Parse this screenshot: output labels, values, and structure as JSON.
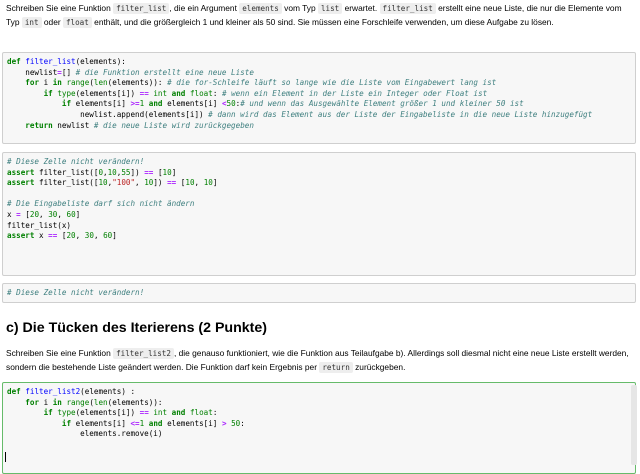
{
  "intro": {
    "t1": "Schreiben Sie eine Funktion ",
    "c1": "filter_list",
    "t2": ", die ein Argument ",
    "c2": "elements",
    "t3": " vom Typ ",
    "c3": "list",
    "t4": " erwartet. ",
    "c4": "filter_list",
    "t5": " erstellt eine neue Liste, die nur die Elemente vom Typ ",
    "c5": "int",
    "t6": " oder ",
    "c6": "float",
    "t7": " enthält, und die größergleich 1 und kleiner als 50 sind. Sie müssen eine Forschleife verwenden, um diese Aufgabe zu lösen."
  },
  "cell1": {
    "lines": [
      "def filter_list(elements):",
      "    newlist=[] # die Funktion erstellt eine neue Liste",
      "    for i in range(len(elements)): # die for-Schleife läuft so lange wie die Liste vom Eingabewert lang ist",
      "        if type(elements[i]) == int and float: # wenn ein Element in der Liste ein Integer oder Float ist",
      "            if elements[i] >=1 and elements[i] <50:# und wenn das Ausgewählte Element größer 1 und kleiner 50 ist",
      "                newlist.append(elements[i]) # dann wird das Element aus der Liste der Eingabeliste in die neue Liste hinzugefügt",
      "    return newlist # die neue Liste wird zurückgegeben"
    ]
  },
  "cell2": {
    "lines": [
      "# Diese Zelle nicht verändern!",
      "assert filter_list([0,10,55]) == [10]",
      "assert filter_list([10,\"100\", 10]) == [10, 10]",
      "",
      "# Die Eingabeliste darf sich nicht ändern",
      "x = [20, 30, 60]",
      "filter_list(x)",
      "assert x == [20, 30, 60]"
    ]
  },
  "cell3": {
    "lines": [
      "# Diese Zelle nicht verändern!"
    ]
  },
  "heading": "c) Die Tücken des Iterierens (2 Punkte)",
  "task": {
    "t1": "Schreiben Sie eine Funktion ",
    "c1": "filter_list2",
    "t2": ", die genauso funktioniert, wie die Funktion aus Teilaufgabe b). Allerdings soll diesmal nicht eine neue Liste erstellt werden, sondern die bestehende Liste geändert werden. Die Funktion darf kein Ergebnis per ",
    "c2": "return",
    "t3": " zurückgeben."
  },
  "cell4": {
    "lines": [
      "def filter_list2(elements) :",
      "    for i in range(len(elements)):",
      "        if type(elements[i]) == int and float:",
      "            if elements[i] <=1 and elements[i] > 50:",
      "                elements.remove(i)"
    ]
  }
}
